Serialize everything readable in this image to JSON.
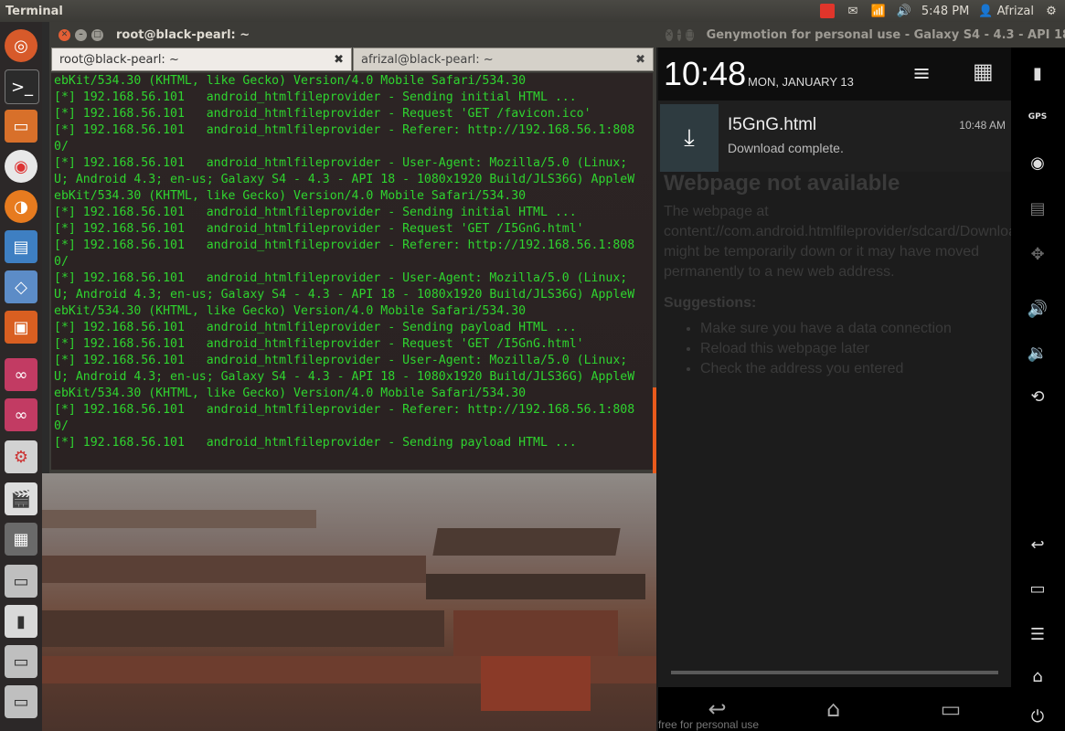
{
  "topbar": {
    "app_name": "Terminal",
    "time": "5:48 PM",
    "user": "Afrizal"
  },
  "launcher": {
    "items": [
      "dash-icon",
      "terminal-icon",
      "files-icon",
      "chrome-icon",
      "firefox-icon",
      "writer-icon",
      "virtualbox-icon",
      "software-center-icon",
      "app-icon-1",
      "app-icon-2",
      "settings-icon",
      "video-editor-icon",
      "workspace-switcher-icon",
      "drive-icon",
      "usb-drive-icon",
      "drive-icon-2",
      "drive-icon-3"
    ]
  },
  "terminal": {
    "title": "root@black-pearl: ~",
    "tabs": [
      "root@black-pearl: ~",
      "afrizal@black-pearl: ~"
    ],
    "lines": [
      "ebKit/534.30 (KHTML, like Gecko) Version/4.0 Mobile Safari/534.30",
      "[*] 192.168.56.101   android_htmlfileprovider - Sending initial HTML ...",
      "[*] 192.168.56.101   android_htmlfileprovider - Request 'GET /favicon.ico'",
      "[*] 192.168.56.101   android_htmlfileprovider - Referer: http://192.168.56.1:808",
      "0/",
      "[*] 192.168.56.101   android_htmlfileprovider - User-Agent: Mozilla/5.0 (Linux;",
      "U; Android 4.3; en-us; Galaxy S4 - 4.3 - API 18 - 1080x1920 Build/JLS36G) AppleW",
      "ebKit/534.30 (KHTML, like Gecko) Version/4.0 Mobile Safari/534.30",
      "[*] 192.168.56.101   android_htmlfileprovider - Sending initial HTML ...",
      "[*] 192.168.56.101   android_htmlfileprovider - Request 'GET /I5GnG.html'",
      "[*] 192.168.56.101   android_htmlfileprovider - Referer: http://192.168.56.1:808",
      "0/",
      "[*] 192.168.56.101   android_htmlfileprovider - User-Agent: Mozilla/5.0 (Linux;",
      "U; Android 4.3; en-us; Galaxy S4 - 4.3 - API 18 - 1080x1920 Build/JLS36G) AppleW",
      "ebKit/534.30 (KHTML, like Gecko) Version/4.0 Mobile Safari/534.30",
      "[*] 192.168.56.101   android_htmlfileprovider - Sending payload HTML ...",
      "[*] 192.168.56.101   android_htmlfileprovider - Request 'GET /I5GnG.html'",
      "[*] 192.168.56.101   android_htmlfileprovider - User-Agent: Mozilla/5.0 (Linux;",
      "U; Android 4.3; en-us; Galaxy S4 - 4.3 - API 18 - 1080x1920 Build/JLS36G) AppleW",
      "ebKit/534.30 (KHTML, like Gecko) Version/4.0 Mobile Safari/534.30",
      "[*] 192.168.56.101   android_htmlfileprovider - Referer: http://192.168.56.1:808",
      "0/",
      "[*] 192.168.56.101   android_htmlfileprovider - Sending payload HTML ..."
    ]
  },
  "genymotion": {
    "title": "Genymotion for personal use - Galaxy S4 - 4.3 - API 18",
    "clock": "10:48",
    "date": "MON, JANUARY 13",
    "notification": {
      "title": "I5GnG.html",
      "subtitle": "Download complete.",
      "time": "10:48 AM"
    },
    "webpage": {
      "heading": "Webpage not available",
      "body": "The webpage at content://com.android.htmlfileprovider/sdcard/Download/I5GnG.html might be temporarily down or it may have moved permanently to a new web address.",
      "suggestions_label": "Suggestions:",
      "suggestions": [
        "Make sure you have a data connection",
        "Reload this webpage later",
        "Check the address you entered"
      ]
    },
    "footer": "free for personal use",
    "sidebar": {
      "gps_label": "GPS"
    }
  }
}
